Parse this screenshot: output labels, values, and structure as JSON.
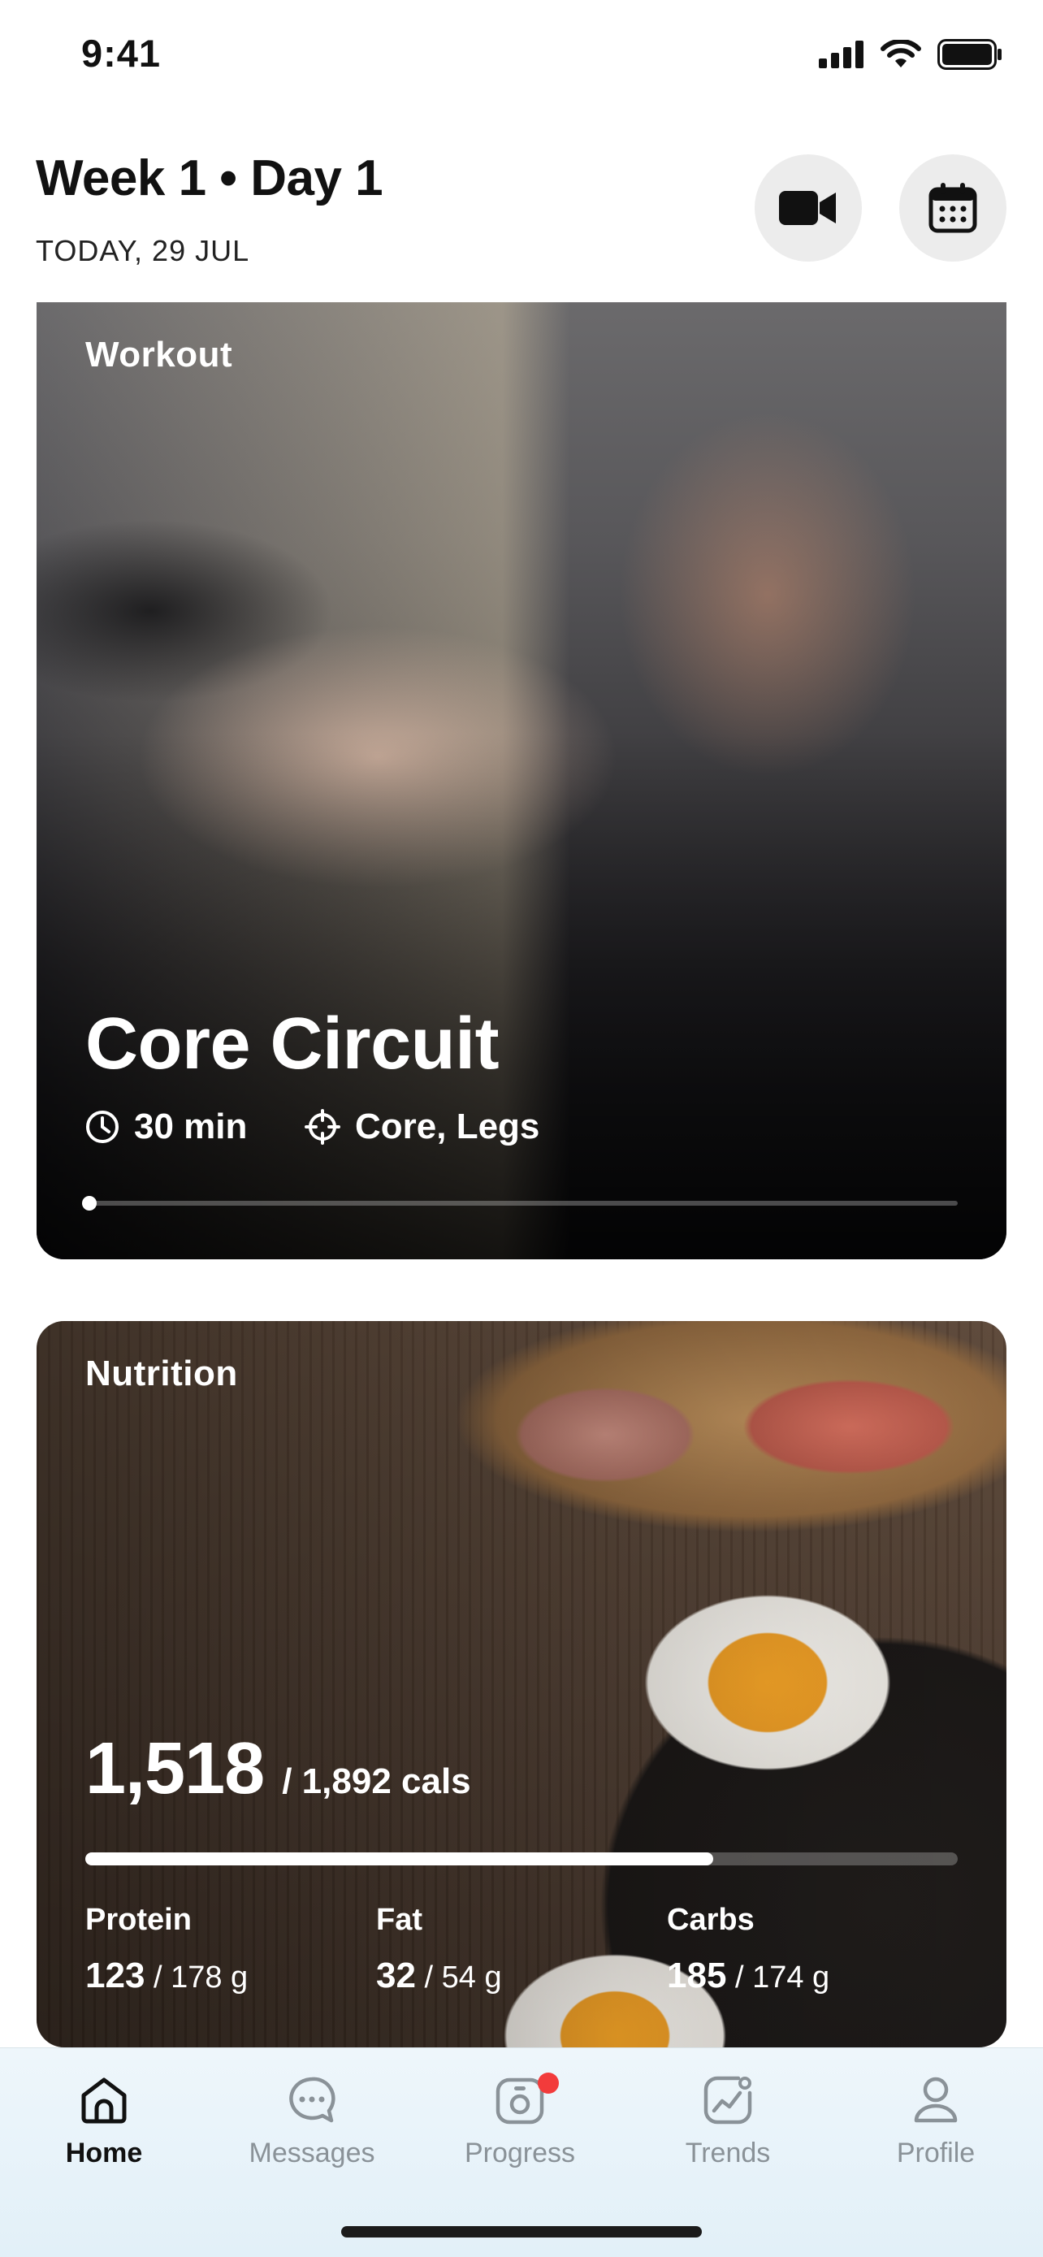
{
  "status_bar": {
    "time": "9:41",
    "icons": [
      "signal-icon",
      "wifi-icon",
      "battery-icon"
    ]
  },
  "header": {
    "title": "Week 1 • Day 1",
    "date": "TODAY, 29 JUL",
    "buttons": {
      "video": "video-camera-icon",
      "calendar": "calendar-icon"
    }
  },
  "workout_card": {
    "label": "Workout",
    "title": "Core Circuit",
    "duration": "30 min",
    "focus": "Core, Legs",
    "progress": 0.0
  },
  "nutrition_card": {
    "label": "Nutrition",
    "calories_consumed": "1,518",
    "calories_goal": "/  1,892 cals",
    "progress": 0.72,
    "macros": [
      {
        "name": "Protein",
        "value": "123",
        "goal": " / 178 g"
      },
      {
        "name": "Fat",
        "value": "32",
        "goal": " / 54 g"
      },
      {
        "name": "Carbs",
        "value": "185",
        "goal": " / 174 g"
      }
    ]
  },
  "tab_bar": {
    "tabs": [
      {
        "label": "Home",
        "icon": "home-icon",
        "active": true
      },
      {
        "label": "Messages",
        "icon": "chat-icon",
        "active": false
      },
      {
        "label": "Progress",
        "icon": "camera-icon",
        "active": false,
        "badge": true
      },
      {
        "label": "Trends",
        "icon": "trends-icon",
        "active": false
      },
      {
        "label": "Profile",
        "icon": "profile-icon",
        "active": false
      }
    ]
  },
  "colors": {
    "badge": "#f23b3b",
    "active_tab": "#111111",
    "inactive_tab": "#8a9298",
    "tabbar_bg": "#e8f3f9"
  }
}
